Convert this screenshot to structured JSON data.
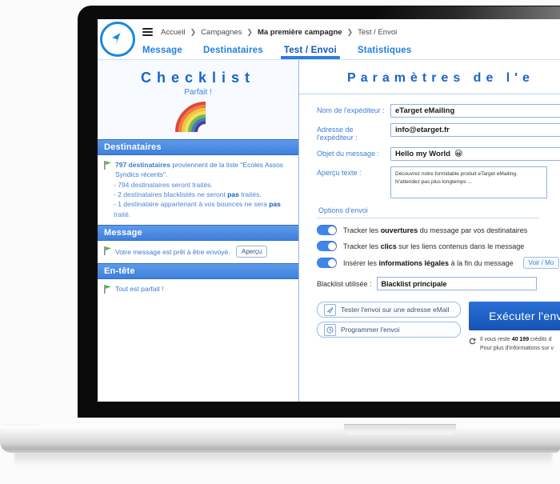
{
  "app": {
    "logo_icon": "navigation-arrow-icon",
    "menu_icon": "hamburger-menu-icon"
  },
  "breadcrumb": {
    "items": [
      {
        "label": "Accueil",
        "bold": false
      },
      {
        "label": "Campagnes",
        "bold": false
      },
      {
        "label": "Ma première campagne",
        "bold": true
      },
      {
        "label": "Test / Envoi",
        "bold": false
      }
    ],
    "separator": "❯"
  },
  "tabs": [
    {
      "label": "Message",
      "active": false
    },
    {
      "label": "Destinataires",
      "active": false
    },
    {
      "label": "Test / Envoi",
      "active": true
    },
    {
      "label": "Statistiques",
      "active": false
    }
  ],
  "checklist": {
    "title": "Checklist",
    "subtitle": "Parfait !",
    "sections": [
      {
        "header": "Destinataires",
        "main_prefix": "797 destinataires",
        "main_rest": " proviennent de la liste \"Ecoles Assos Syndics récents\".",
        "sub_items": [
          {
            "pre": "- 794 destinataires seront traités.",
            "bold": "",
            "post": ""
          },
          {
            "pre": "- 2 destinataires blacklistés ne seront ",
            "bold": "pas",
            "post": " traités."
          },
          {
            "pre": "- 1 destinataire appartenant à vos bounces ne sera ",
            "bold": "pas",
            "post": " traité."
          }
        ]
      },
      {
        "header": "Message",
        "line": "Votre message est prêt à être envoyé.",
        "button": "Aperçu"
      },
      {
        "header": "En-tête",
        "line": "Tout est parfait !"
      }
    ]
  },
  "settings": {
    "title": "Paramètres de l'e",
    "fields": [
      {
        "label": "Nom de l'expéditeur :",
        "value": "eTarget eMailing"
      },
      {
        "label": "Adresse de l'expéditeur :",
        "value": "info@etarget.fr"
      },
      {
        "label": "Objet du message :",
        "value": "Hello my World",
        "emoji": "😀"
      }
    ],
    "preview": {
      "label": "Aperçu texte :",
      "line1": "Découvrez notre formidable produit eTarget eMailing.",
      "line2": "N'attendez pas plus longtemps ..."
    },
    "options_title": "Options d'envoi",
    "options": [
      {
        "pre": "Tracker les ",
        "bold": "ouvertures",
        "post": " du message par vos destinataires",
        "on": true,
        "button": ""
      },
      {
        "pre": "Tracker les ",
        "bold": "clics",
        "post": " sur les liens contenus dans le message",
        "on": true,
        "button": ""
      },
      {
        "pre": "Insérer les ",
        "bold": "informations légales",
        "post": " à la fin du message",
        "on": true,
        "button": "Voir / Mo"
      }
    ],
    "blacklist": {
      "label": "Blacklist utilisée :",
      "value": "Blacklist principale"
    },
    "actions": [
      {
        "label": "Tester l'envoi sur une adresse eMail",
        "icon": "test-send-icon"
      },
      {
        "label": "Programmer l'envoi",
        "icon": "clock-icon"
      }
    ],
    "send_button": "Exécuter l'env",
    "credits": {
      "line1_pre": "Il vous reste ",
      "line1_bold": "40 199",
      "line1_post": " crédits d",
      "line2": "Pour plus d'informations sur v",
      "icon": "refresh-icon"
    }
  },
  "colors": {
    "accent_blue": "#1f7fe0",
    "header_blue": "#3f80dd",
    "send_button": "#1753b5",
    "toggle_on": "#3f86e8",
    "flag_green": "#52b948"
  }
}
